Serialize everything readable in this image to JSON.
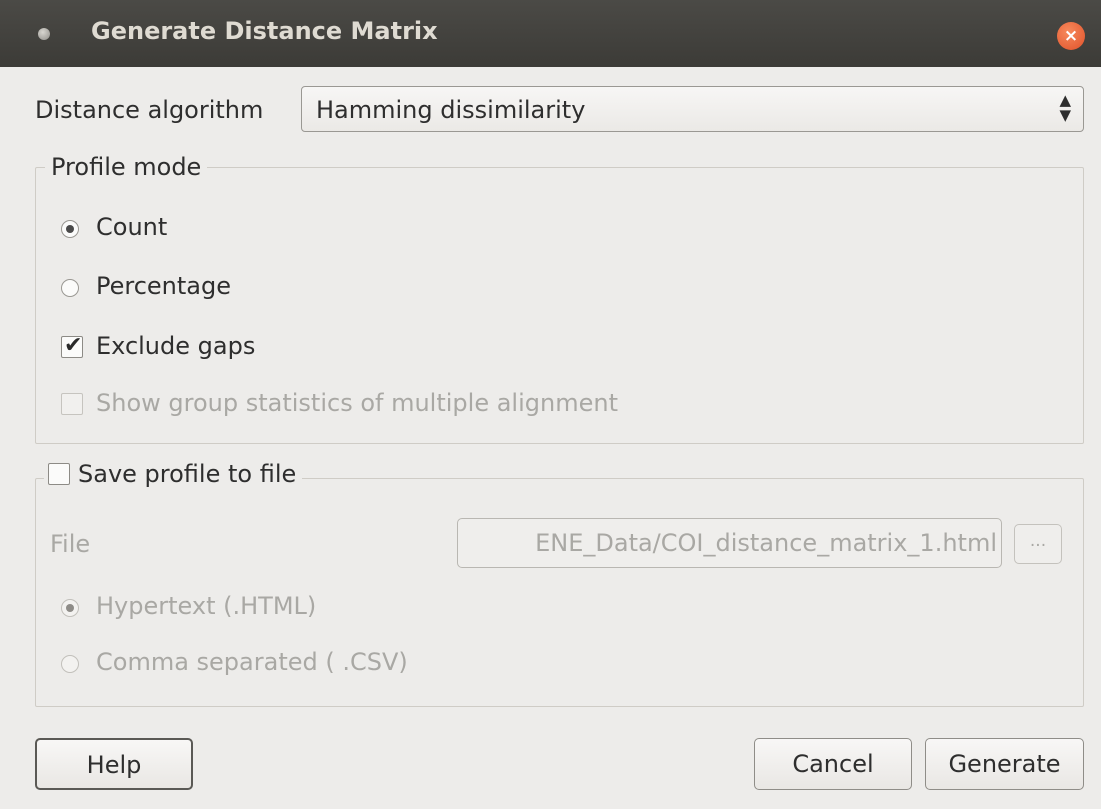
{
  "window": {
    "title": "Generate Distance Matrix",
    "close_label": "×"
  },
  "algorithm": {
    "label": "Distance algorithm",
    "selected": "Hamming dissimilarity",
    "arrows_up": "▲",
    "arrows_down": "▼"
  },
  "profile_mode": {
    "title": "Profile mode",
    "count_label": "Count",
    "count_checked": true,
    "percentage_label": "Percentage",
    "percentage_checked": false,
    "exclude_gaps_label": "Exclude gaps",
    "exclude_gaps_checked": true,
    "group_stats_label": "Show group statistics of multiple alignment",
    "group_stats_checked": false,
    "check_mark": "✔"
  },
  "save_profile": {
    "title": "Save profile to file",
    "checked": false,
    "file_label": "File",
    "file_value": "ENE_Data/COI_distance_matrix_1.html",
    "browse_label": "...",
    "html_label": "Hypertext  (.HTML)",
    "html_checked": true,
    "csv_label": "Comma separated ( .CSV)",
    "csv_checked": false
  },
  "buttons": {
    "help": "Help",
    "cancel": "Cancel",
    "generate": "Generate"
  }
}
